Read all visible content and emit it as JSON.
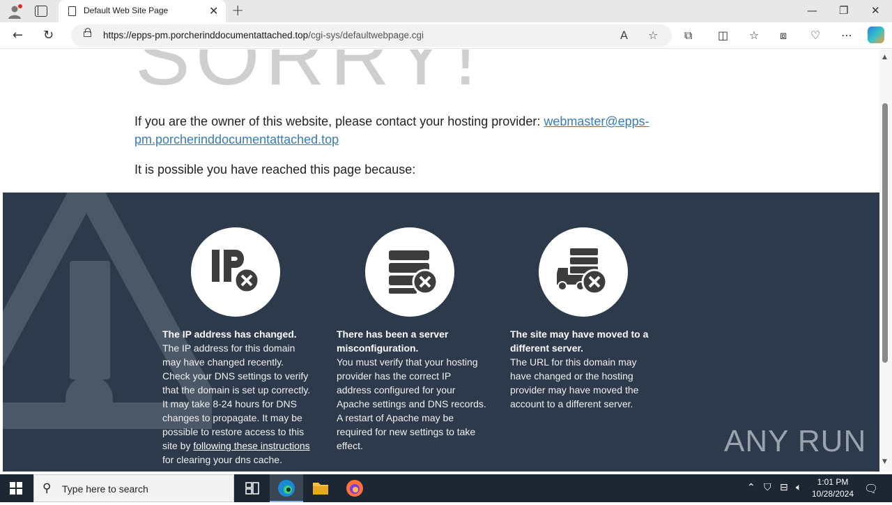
{
  "browser": {
    "tab_title": "Default Web Site Page",
    "url_host": "https://epps-pm.porcherinddocumentattached.top",
    "url_path": "/cgi-sys/defaultwebpage.cgi"
  },
  "page": {
    "sorry_text": "SORRY!",
    "owner_text": "If you are the owner of this website, please contact your hosting provider: ",
    "owner_link": "webmaster@epps-pm.porcherinddocumentattached.top",
    "reason_text": "It is possible you have reached this page because:",
    "columns": [
      {
        "head": "The IP address has changed.",
        "body": "The IP address for this domain may have changed recently. Check your DNS settings to verify that the domain is set up correctly. It may take 8-24 hours for DNS changes to propagate. It may be possible to restore access to this site by ",
        "link": "following these instructions",
        "tail": " for clearing your dns cache."
      },
      {
        "head": "There has been a server misconfiguration.",
        "body": "You must verify that your hosting provider has the correct IP address configured for your Apache settings and DNS records. A restart of Apache may be required for new settings to take effect."
      },
      {
        "head": "The site may have moved to a different server.",
        "body": "The URL for this domain may have changed or the hosting provider may have moved the account to a different server."
      }
    ],
    "watermark": "ANY RUN"
  },
  "taskbar": {
    "search_placeholder": "Type here to search",
    "time": "1:01 PM",
    "date": "10/28/2024"
  },
  "icons": {
    "col1": "ip-error-icon",
    "col2": "server-error-icon",
    "col3": "moving-truck-error-icon"
  }
}
